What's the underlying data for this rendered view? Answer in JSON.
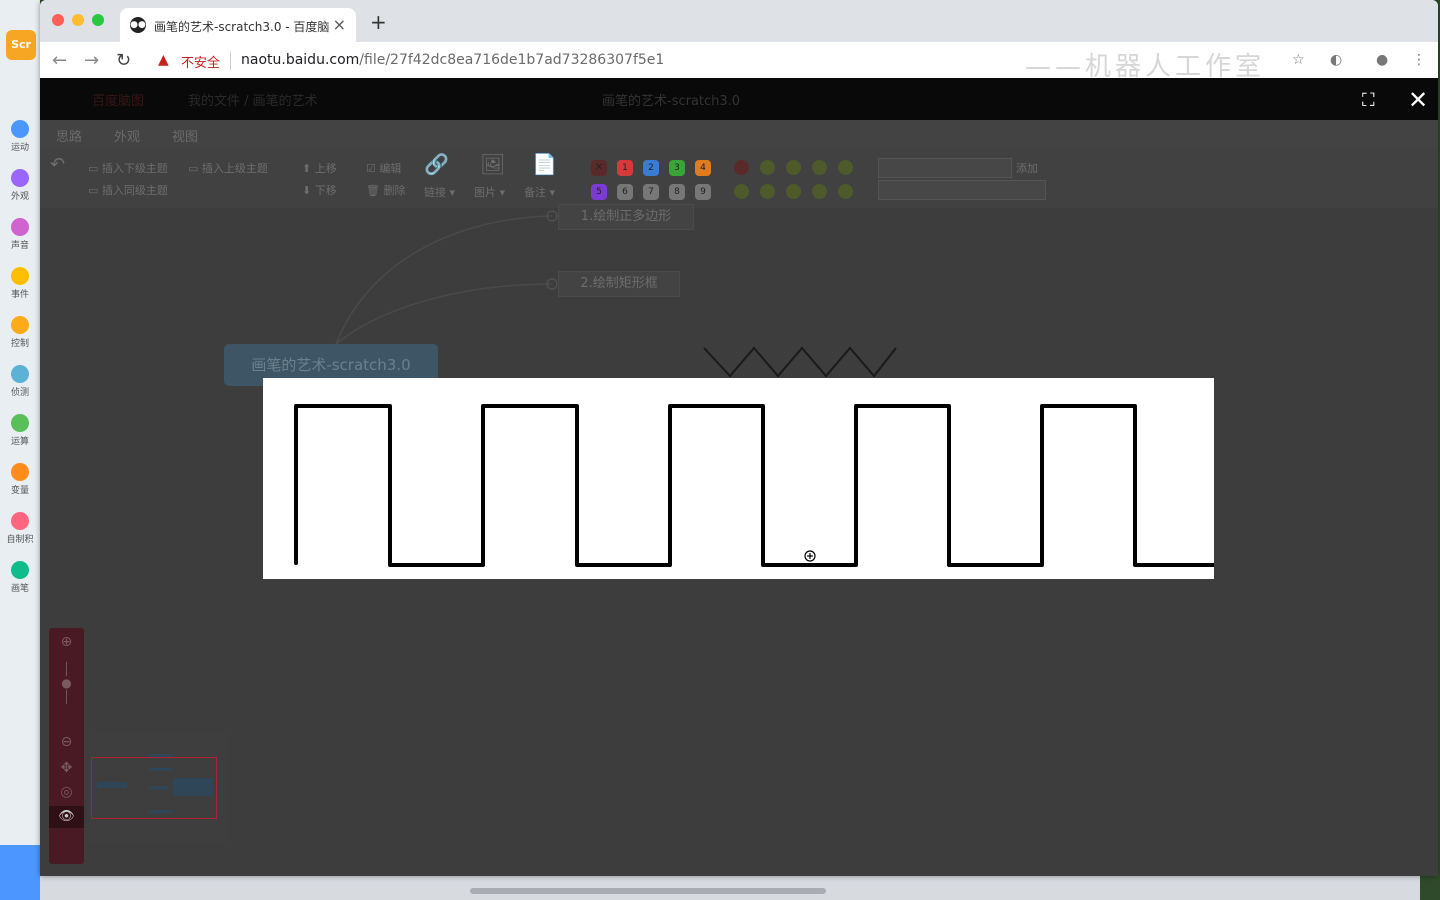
{
  "scratch_app": {
    "logo_text": "Scr",
    "categories": [
      {
        "label": "运动",
        "color": "#4c97ff"
      },
      {
        "label": "外观",
        "color": "#9966ff"
      },
      {
        "label": "声音",
        "color": "#cf63cf"
      },
      {
        "label": "事件",
        "color": "#ffbf00"
      },
      {
        "label": "控制",
        "color": "#ffab19"
      },
      {
        "label": "侦测",
        "color": "#5cb1d6"
      },
      {
        "label": "运算",
        "color": "#59c059"
      },
      {
        "label": "变量",
        "color": "#ff8c1a"
      },
      {
        "label": "自制积",
        "color": "#ff6680"
      },
      {
        "label": "画笔",
        "color": "#0fbd8c"
      }
    ]
  },
  "browser": {
    "tab_title": "画笔的艺术-scratch3.0 - 百度脑",
    "tab_close": "×",
    "new_tab": "+",
    "security_warning": "不安全",
    "url_host": "naotu.baidu.com",
    "url_path": "/file/27f42dc8ea716de1b7ad73286307f5e1",
    "watermark": "——机器人工作室"
  },
  "editor": {
    "topbar": {
      "menu_label": "百度脑图",
      "doc_path": "我的文件 / 画笔的艺术",
      "doc_title": "画笔的艺术-scratch3.0"
    },
    "menu_tabs": [
      "思路",
      "外观",
      "视图"
    ],
    "toolbar": {
      "insert_child": "插入下级主题",
      "insert_parent": "插入上级主题",
      "insert_sibling": "插入同级主题",
      "move_up": "上移",
      "move_down": "下移",
      "edit": "编辑",
      "delete": "删除",
      "link": "链接",
      "image": "图片",
      "note": "备注",
      "tag_add": "添加"
    },
    "priorities": [
      "1",
      "2",
      "3",
      "4",
      "5",
      "6",
      "7",
      "8",
      "9"
    ],
    "nodes": {
      "root": "画笔的艺术-scratch3.0",
      "child1": "1.绘制正多边形",
      "child2": "2.绘制矩形框"
    }
  },
  "preview": {
    "description_color": "#000000"
  },
  "colors": {
    "priority": [
      "#d43a3a",
      "#3a7bd4",
      "#3aa33a",
      "#e07b1f",
      "#7b3ad4",
      "#777777",
      "#777777",
      "#777777",
      "#777777"
    ],
    "accent_dark_red": "#4a1a24"
  }
}
